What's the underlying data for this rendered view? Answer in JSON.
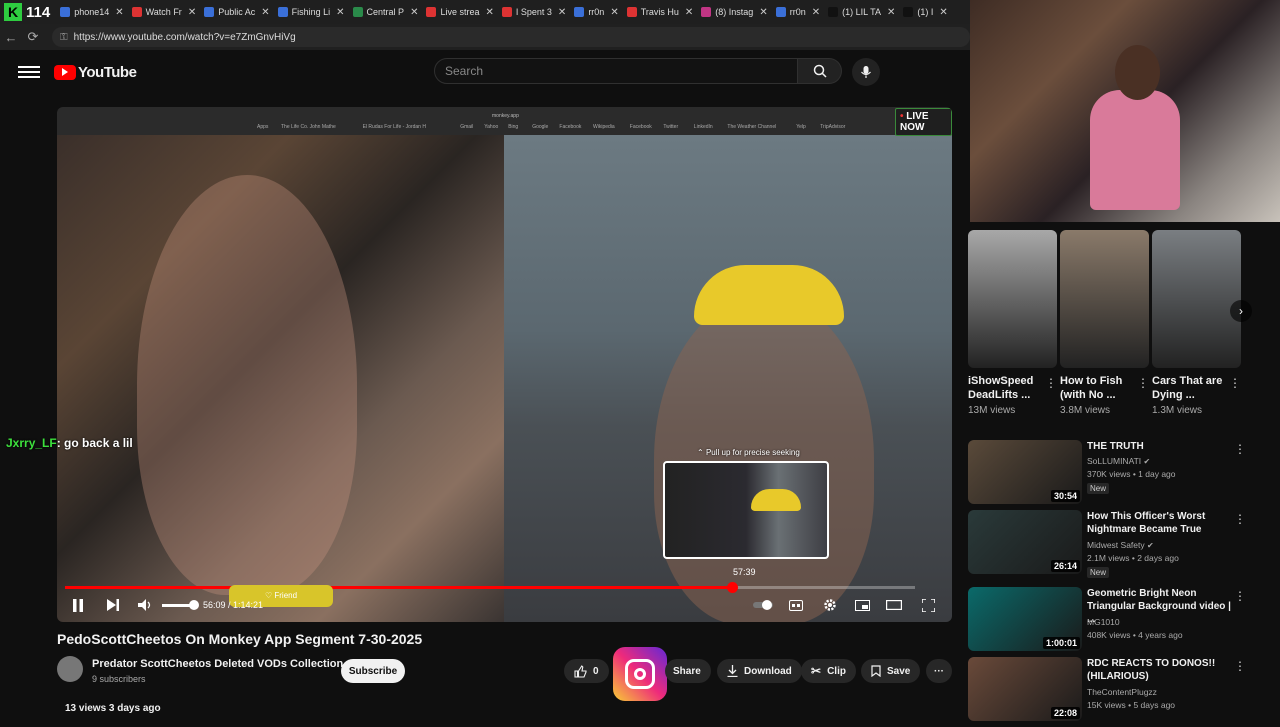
{
  "browser": {
    "tab_count": "114",
    "tabs": [
      {
        "label": "phone14",
        "color": "#3a6fd8"
      },
      {
        "label": "Watch Fr",
        "color": "#d33"
      },
      {
        "label": "Public Ac",
        "color": "#3a6fd8"
      },
      {
        "label": "Fishing Li",
        "color": "#3a6fd8"
      },
      {
        "label": "Central P",
        "color": "#2a8a4a"
      },
      {
        "label": "Live strea",
        "color": "#d33"
      },
      {
        "label": "I Spent 3",
        "color": "#d33"
      },
      {
        "label": "rr0n",
        "color": "#3a6fd8"
      },
      {
        "label": "Travis Hu",
        "color": "#d33"
      },
      {
        "label": "(8) Instag",
        "color": "#c13584"
      },
      {
        "label": "rr0n",
        "color": "#3a6fd8"
      },
      {
        "label": "(1) LIL TA",
        "color": "#111111"
      },
      {
        "label": "(1) I",
        "color": "#111111"
      }
    ],
    "url": "https://www.youtube.com/watch?v=e7ZmGnvHiVg"
  },
  "header": {
    "logo_text": "YouTube",
    "search_placeholder": "Search"
  },
  "player": {
    "live_badge": "LIVE NOW",
    "inner_title": "monkey.app",
    "bookmarks": [
      "Apps",
      "The Life Co. John Mathe",
      "El Rudas For Life - Jordan H",
      "Gmail",
      "Yahoo",
      "Bing",
      "Google",
      "Facebook",
      "Wikipedia",
      "Facebook",
      "Twitter",
      "LinkedIn",
      "The Weather Channel",
      "Yelp",
      "TripAdvisor"
    ],
    "chat_user": "Jxrry_LF",
    "chat_message": ": go back a lil",
    "seek_hint": "Pull up for precise seeking",
    "preview_time": "57:39",
    "progress_fraction": 0.785,
    "time_display": "56:09 / 1:14:21",
    "friend_label": "Friend"
  },
  "video": {
    "title": "PedoScottCheetos On Monkey App Segment 7-30-2025",
    "channel": "Predator ScottCheetos Deleted VODs Collection",
    "subscribers": "9 subscribers",
    "subscribe_label": "Subscribe",
    "likes": "0",
    "share_label": "Share",
    "download_label": "Download",
    "clip_label": "Clip",
    "save_label": "Save",
    "views_line": "13 views  3 days ago"
  },
  "shorts": [
    {
      "title": "iShowSpeed DeadLifts ...",
      "views": "13M views",
      "color": "#a8a8a8"
    },
    {
      "title": "How to Fish (with No ...",
      "views": "3.8M views",
      "color": "#8a7a6a"
    },
    {
      "title": "Cars That are Dying ...",
      "views": "1.3M views",
      "color": "#7a7e82"
    }
  ],
  "recommendations": [
    {
      "title": "THE TRUTH",
      "channel": "SoLLUMINATI",
      "meta": "370K views • 1 day ago",
      "badge": "New",
      "duration": "30:54",
      "color": "#5a4a3a",
      "verified": true
    },
    {
      "title": "How This Officer's Worst Nightmare Became True",
      "channel": "Midwest Safety",
      "meta": "2.1M views • 2 days ago",
      "badge": "New",
      "duration": "26:14",
      "color": "#2a3a3a",
      "verified": true
    },
    {
      "title": "Geometric Bright Neon Triangular Background video | ...",
      "channel": "MG1010",
      "meta": "408K views • 4 years ago",
      "badge": "",
      "duration": "1:00:01",
      "color": "#0a6a6a",
      "verified": false
    },
    {
      "title": "RDC REACTS TO DONOS!! (HILARIOUS)",
      "channel": "TheContentPlugzz",
      "meta": "15K views • 5 days ago",
      "badge": "",
      "duration": "22:08",
      "color": "#6a4a3a",
      "verified": false
    }
  ]
}
